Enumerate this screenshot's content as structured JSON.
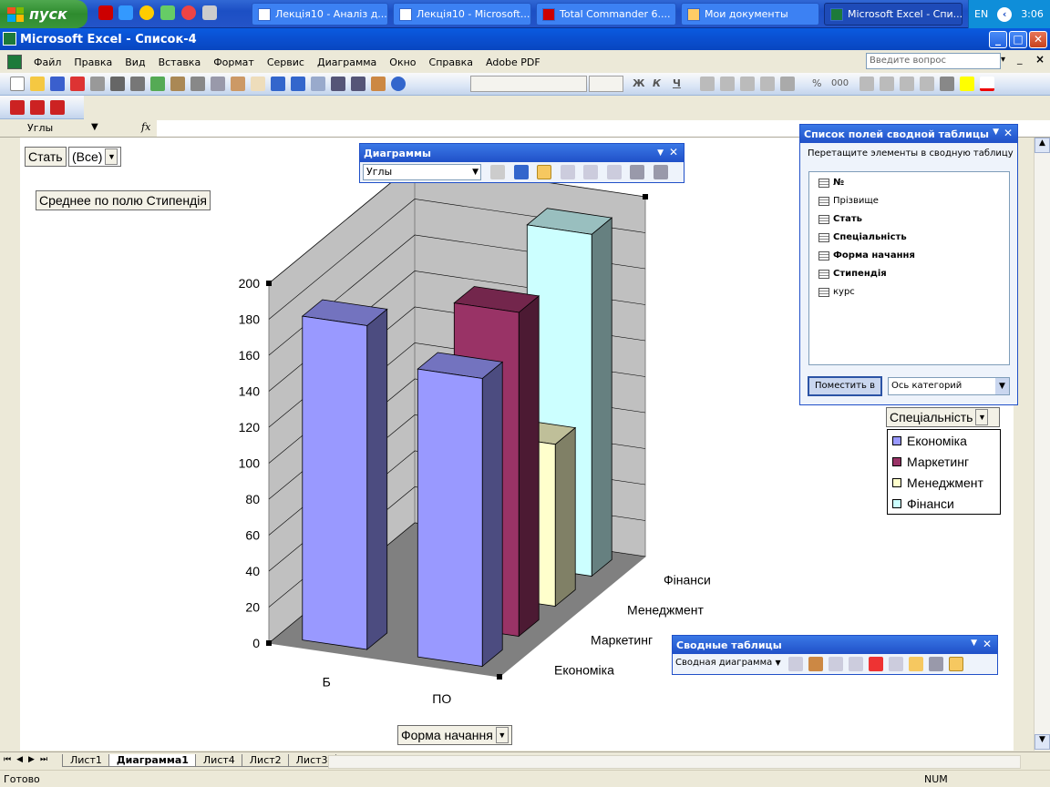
{
  "taskbar": {
    "start_label": "пуск",
    "tasks": [
      {
        "label": "Лекція10 - Аналіз д..."
      },
      {
        "label": "Лекція10 - Microsoft..."
      },
      {
        "label": "Total Commander 6...."
      },
      {
        "label": "Мои документы"
      },
      {
        "label": "Microsoft Excel - Спи..."
      }
    ],
    "lang": "EN",
    "time": "3:06"
  },
  "window": {
    "title": "Microsoft Excel - Список-4",
    "minimize": "_",
    "maximize": "□",
    "close": "✕"
  },
  "menu": {
    "items": [
      "Файл",
      "Правка",
      "Вид",
      "Вставка",
      "Формат",
      "Сервис",
      "Диаграмма",
      "Окно",
      "Справка",
      "Adobe PDF"
    ],
    "ask_placeholder": "Введите вопрос"
  },
  "formatting": {
    "bold": "Ж",
    "italic": "К",
    "underline": "Ч",
    "percent": "%",
    "thousands": "000"
  },
  "namebox": {
    "value": "Углы",
    "fx": "fx"
  },
  "pivot_chart": {
    "page_field": "Стать",
    "page_value": "(Все)",
    "data_field": "Среднее по полю Стипендія",
    "category_field": "Форма начання",
    "series_field": "Спеціальність"
  },
  "chart_data": {
    "type": "bar",
    "categories": [
      "Б",
      "ПО"
    ],
    "series": [
      {
        "name": "Економіка",
        "values": [
          180,
          160
        ]
      },
      {
        "name": "Маркетинг",
        "values": [
          0,
          180
        ]
      },
      {
        "name": "Менеджмент",
        "values": [
          0,
          90
        ]
      },
      {
        "name": "Фінанси",
        "values": [
          0,
          190
        ]
      }
    ],
    "depth_labels": [
      "Економіка",
      "Маркетинг",
      "Менеджмент",
      "Фінанси"
    ],
    "y_ticks": [
      "0",
      "20",
      "40",
      "60",
      "80",
      "100",
      "120",
      "140",
      "160",
      "180",
      "200"
    ],
    "ylim": [
      0,
      200
    ],
    "colors": [
      "#9999ff",
      "#993366",
      "#ffffcc",
      "#ccffff"
    ],
    "grid": true,
    "legend_position": "right"
  },
  "charts_toolbar": {
    "title": "Диаграммы",
    "object_value": "Углы"
  },
  "field_list": {
    "title": "Список полей сводной таблицы",
    "instruction": "Перетащите элементы в сводную таблицу",
    "fields": [
      {
        "label": "№",
        "bold": true
      },
      {
        "label": "Прізвище",
        "bold": false
      },
      {
        "label": "Стать",
        "bold": true
      },
      {
        "label": "Спеціальність",
        "bold": true
      },
      {
        "label": "Форма начання",
        "bold": true
      },
      {
        "label": "Стипендія",
        "bold": true
      },
      {
        "label": "курс",
        "bold": false
      }
    ],
    "place_button": "Поместить в",
    "area_value": "Ось категорий"
  },
  "pivot_toolbar": {
    "title": "Сводные таблицы",
    "menu_label": "Сводная диаграмма"
  },
  "sheet_tabs": [
    "Лист1",
    "Диаграмма1",
    "Лист4",
    "Лист2",
    "Лист3"
  ],
  "active_tab": "Диаграмма1",
  "status": {
    "ready": "Готово",
    "num": "NUM"
  }
}
